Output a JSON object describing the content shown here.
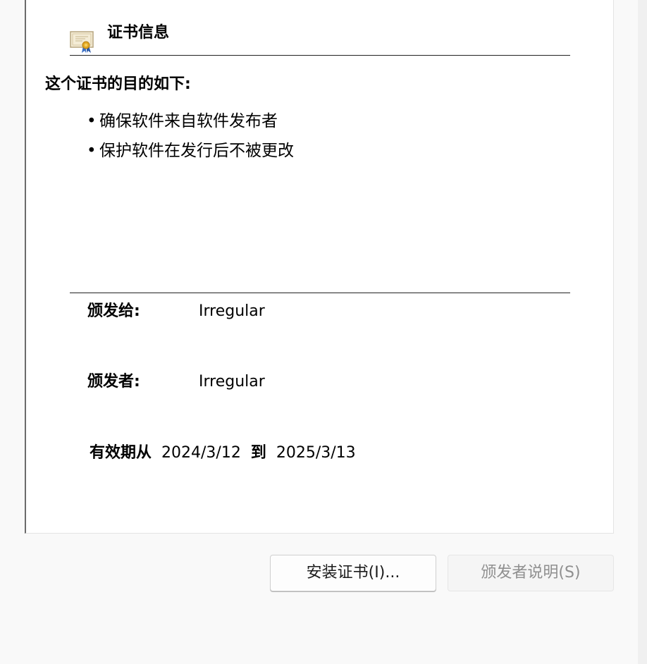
{
  "header": {
    "title": "证书信息",
    "icon": "certificate-icon"
  },
  "purpose": {
    "heading": "这个证书的目的如下:",
    "bullet": "•",
    "items": [
      "确保软件来自软件发布者",
      "保护软件在发行后不被更改"
    ]
  },
  "details": {
    "issued_to_label": "颁发给:",
    "issued_to_value": "Irregular",
    "issued_by_label": "颁发者:",
    "issued_by_value": "Irregular",
    "valid_from_label": "有效期从",
    "valid_from_value": "2024/3/12",
    "valid_to_label": "到",
    "valid_to_value": "2025/3/13"
  },
  "buttons": {
    "install_label": "安装证书(I)...",
    "issuer_statement_label": "颁发者说明(S)",
    "issuer_statement_enabled": false
  },
  "colors": {
    "panel_background": "#ffffff",
    "window_background": "#f9f9f9",
    "disabled_text": "#8f8f8f"
  }
}
